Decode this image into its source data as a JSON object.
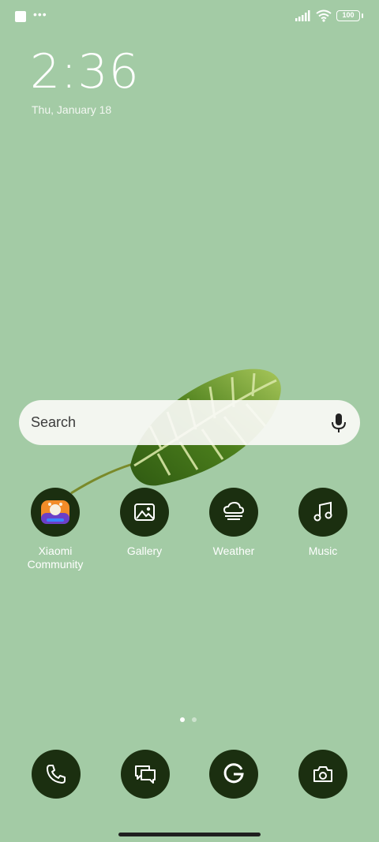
{
  "status_bar": {
    "battery": "100"
  },
  "clock": {
    "time": "2:36",
    "date": "Thu, January 18"
  },
  "search": {
    "placeholder": "Search"
  },
  "apps": [
    {
      "label": "Xiaomi\nCommunity",
      "icon": "xiaomi-community-icon"
    },
    {
      "label": "Gallery",
      "icon": "gallery-icon"
    },
    {
      "label": "Weather",
      "icon": "weather-icon"
    },
    {
      "label": "Music",
      "icon": "music-icon"
    }
  ],
  "dock": [
    {
      "icon": "phone-icon"
    },
    {
      "icon": "messages-icon"
    },
    {
      "icon": "google-icon"
    },
    {
      "icon": "camera-icon"
    }
  ],
  "page_indicator": {
    "pages": 2,
    "current": 1
  },
  "colors": {
    "background": "#a3cba5",
    "icon_bg": "#1b2f10",
    "search_bg": "#fafaf6"
  }
}
